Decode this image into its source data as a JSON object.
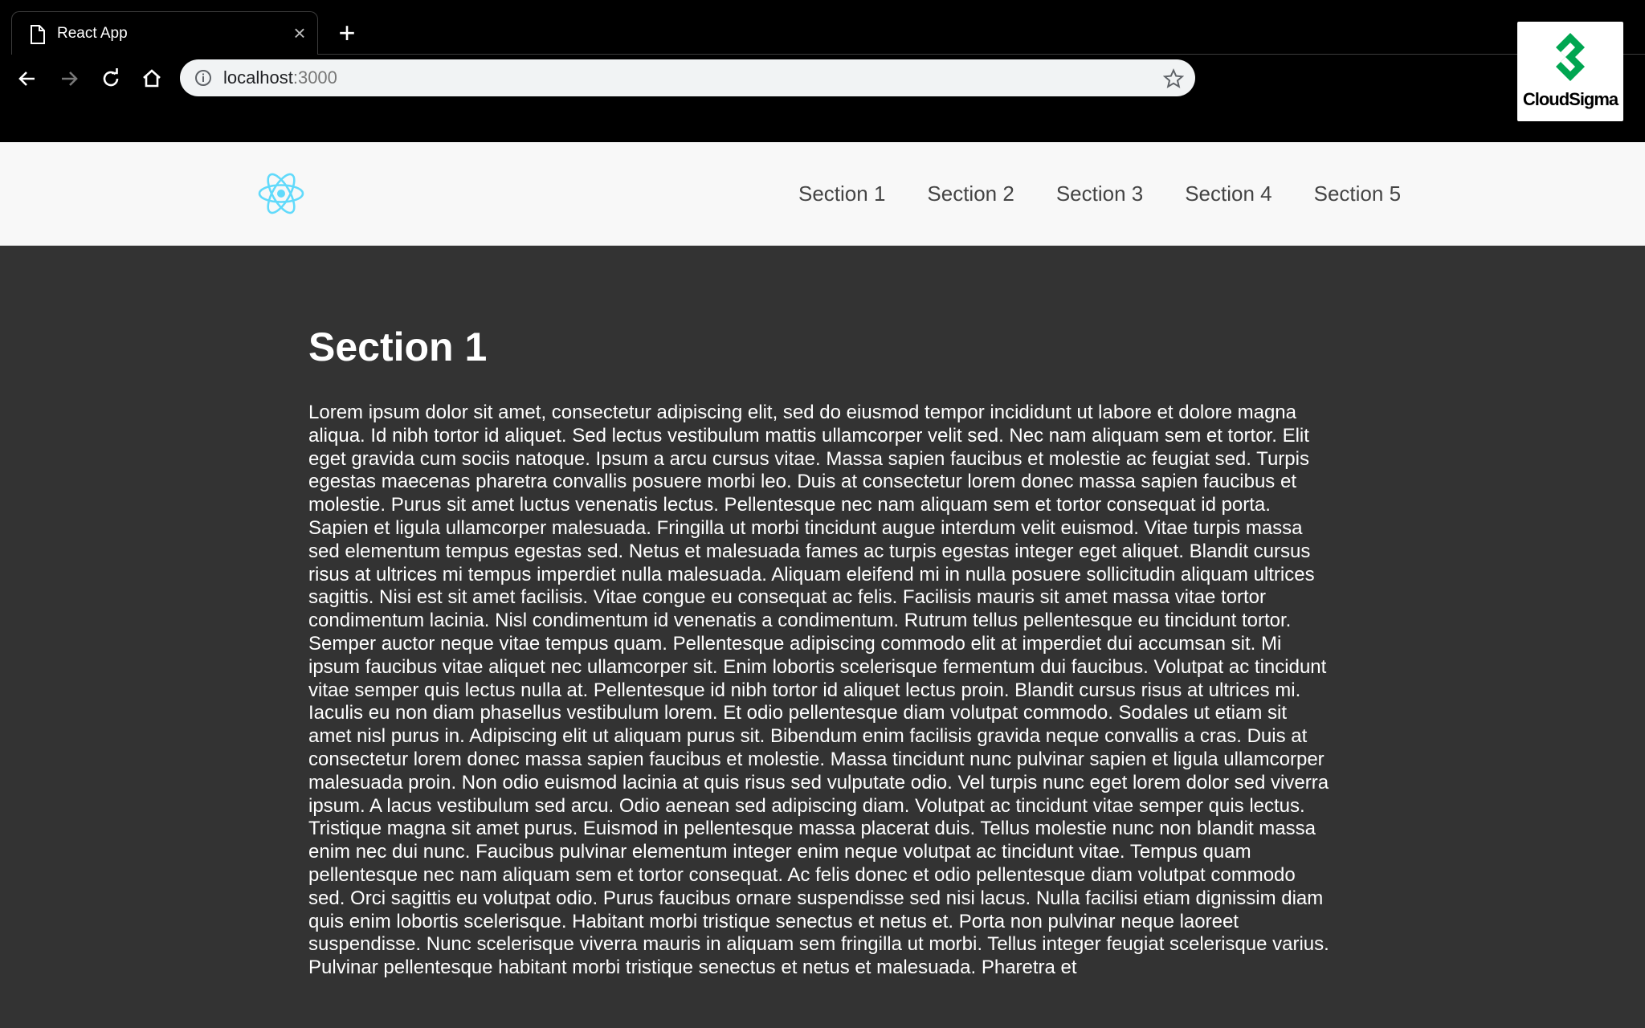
{
  "browser": {
    "tab_title": "React App",
    "tab_close": "×",
    "new_tab": "+",
    "url_host": "localhost",
    "url_port": ":3000",
    "icons": [
      "page-icon",
      "close-icon",
      "plus-icon",
      "back-arrow-icon",
      "forward-arrow-icon",
      "reload-icon",
      "home-icon",
      "info-icon",
      "star-icon"
    ]
  },
  "brand_badge": {
    "text": "CloudSigma",
    "color": "#00a651"
  },
  "header": {
    "logo": "react-logo",
    "logo_color": "#61dafb",
    "nav": [
      "Section 1",
      "Section 2",
      "Section 3",
      "Section 4",
      "Section 5"
    ]
  },
  "main": {
    "title": "Section 1",
    "body": "Lorem ipsum dolor sit amet, consectetur adipiscing elit, sed do eiusmod tempor incididunt ut labore et dolore magna aliqua. Id nibh tortor id aliquet. Sed lectus vestibulum mattis ullamcorper velit sed. Nec nam aliquam sem et tortor. Elit eget gravida cum sociis natoque. Ipsum a arcu cursus vitae. Massa sapien faucibus et molestie ac feugiat sed. Turpis egestas maecenas pharetra convallis posuere morbi leo. Duis at consectetur lorem donec massa sapien faucibus et molestie. Purus sit amet luctus venenatis lectus. Pellentesque nec nam aliquam sem et tortor consequat id porta. Sapien et ligula ullamcorper malesuada. Fringilla ut morbi tincidunt augue interdum velit euismod. Vitae turpis massa sed elementum tempus egestas sed. Netus et malesuada fames ac turpis egestas integer eget aliquet. Blandit cursus risus at ultrices mi tempus imperdiet nulla malesuada. Aliquam eleifend mi in nulla posuere sollicitudin aliquam ultrices sagittis. Nisi est sit amet facilisis. Vitae congue eu consequat ac felis. Facilisis mauris sit amet massa vitae tortor condimentum lacinia. Nisl condimentum id venenatis a condimentum. Rutrum tellus pellentesque eu tincidunt tortor. Semper auctor neque vitae tempus quam. Pellentesque adipiscing commodo elit at imperdiet dui accumsan sit. Mi ipsum faucibus vitae aliquet nec ullamcorper sit. Enim lobortis scelerisque fermentum dui faucibus. Volutpat ac tincidunt vitae semper quis lectus nulla at. Pellentesque id nibh tortor id aliquet lectus proin. Blandit cursus risus at ultrices mi. Iaculis eu non diam phasellus vestibulum lorem. Et odio pellentesque diam volutpat commodo. Sodales ut etiam sit amet nisl purus in. Adipiscing elit ut aliquam purus sit. Bibendum enim facilisis gravida neque convallis a cras. Duis at consectetur lorem donec massa sapien faucibus et molestie. Massa tincidunt nunc pulvinar sapien et ligula ullamcorper malesuada proin. Non odio euismod lacinia at quis risus sed vulputate odio. Vel turpis nunc eget lorem dolor sed viverra ipsum. A lacus vestibulum sed arcu. Odio aenean sed adipiscing diam. Volutpat ac tincidunt vitae semper quis lectus. Tristique magna sit amet purus. Euismod in pellentesque massa placerat duis. Tellus molestie nunc non blandit massa enim nec dui nunc. Faucibus pulvinar elementum integer enim neque volutpat ac tincidunt vitae. Tempus quam pellentesque nec nam aliquam sem et tortor consequat. Ac felis donec et odio pellentesque diam volutpat commodo sed. Orci sagittis eu volutpat odio. Purus faucibus ornare suspendisse sed nisi lacus. Nulla facilisi etiam dignissim diam quis enim lobortis scelerisque. Habitant morbi tristique senectus et netus et. Porta non pulvinar neque laoreet suspendisse. Nunc scelerisque viverra mauris in aliquam sem fringilla ut morbi. Tellus integer feugiat scelerisque varius. Pulvinar pellentesque habitant morbi tristique senectus et netus et malesuada. Pharetra et"
  }
}
